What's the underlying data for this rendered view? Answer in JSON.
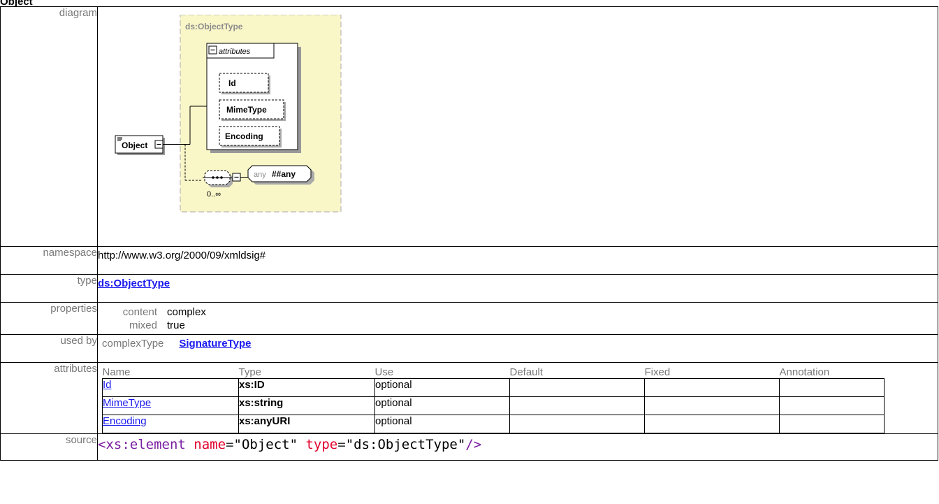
{
  "page": {
    "title": "Object"
  },
  "labels": {
    "diagram": "diagram",
    "namespace": "namespace",
    "type": "type",
    "properties": "properties",
    "used_by": "used by",
    "attributes": "attributes",
    "source": "source"
  },
  "diagram": {
    "type_box_title": "ds:ObjectType",
    "attributes_group_label": "attributes",
    "attributes": [
      "Id",
      "MimeType",
      "Encoding"
    ],
    "element_name": "Object",
    "any_prefix": "any",
    "any_value": "##any",
    "sequence_cardinality": "0..∞",
    "colors": {
      "type_box_fill": "#f9f6c8",
      "type_box_border": "#b8b8b8",
      "title_text": "#8c8c8c"
    },
    "icons": [
      "collapse-minus-icon",
      "sequence-icon",
      "element-doc-icon"
    ]
  },
  "namespace": {
    "value": "http://www.w3.org/2000/09/xmldsig#"
  },
  "type": {
    "value": "ds:ObjectType"
  },
  "properties": {
    "content_key": "content",
    "content_value": "complex",
    "mixed_key": "mixed",
    "mixed_value": "true"
  },
  "used_by": {
    "kind": "complexType",
    "value": "SignatureType"
  },
  "attributes_table": {
    "headers": [
      "Name",
      "Type",
      "Use",
      "Default",
      "Fixed",
      "Annotation"
    ],
    "rows": [
      {
        "name": "Id",
        "type": "xs:ID",
        "use": "optional"
      },
      {
        "name": "MimeType",
        "type": "xs:string",
        "use": "optional"
      },
      {
        "name": "Encoding",
        "type": "xs:anyURI",
        "use": "optional"
      }
    ]
  },
  "source": {
    "tag_open": "<xs:element",
    "attr1_name": "name",
    "attr1_value": "\"Object\"",
    "attr2_name": "type",
    "attr2_value": "\"ds:ObjectType\"",
    "tag_close": "/>",
    "equals": "="
  },
  "theme": {
    "link_color": "#1a1aee",
    "label_color": "#777777",
    "source_tag_color": "#7a1fa2",
    "source_attr_color": "#e0002a"
  }
}
